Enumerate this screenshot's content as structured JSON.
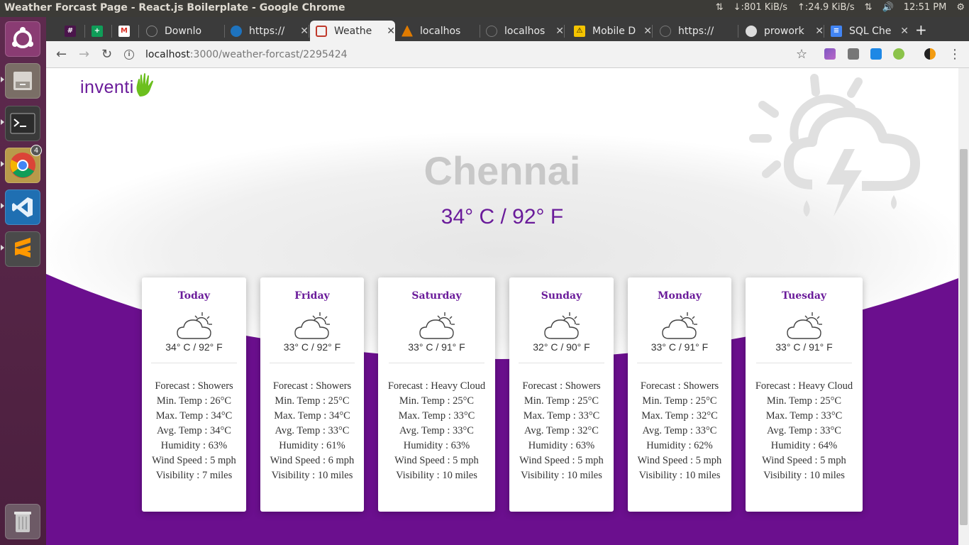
{
  "os": {
    "window_title": "Weather Forcast Page - React.js Boilerplate - Google Chrome",
    "net_down": "↓:801 KiB/s",
    "net_up": "↑:24.9 KiB/s",
    "clock": "12:51 PM",
    "chrome_badge": "4"
  },
  "tabs": [
    {
      "label": "",
      "fav_color": "#4a154b"
    },
    {
      "label": "",
      "fav_color": "#0f9d58"
    },
    {
      "label": "",
      "fav_color": "#ffffff"
    },
    {
      "label": "Downlo",
      "fav_color": "#555555"
    },
    {
      "label": "https://",
      "fav_color": "#1e73be"
    },
    {
      "label": "Weathe",
      "fav_color": "#c0392b"
    },
    {
      "label": "localhos",
      "fav_color": "#e07b00"
    },
    {
      "label": "localhos",
      "fav_color": "#555555"
    },
    {
      "label": "Mobile D",
      "fav_color": "#f5c400"
    },
    {
      "label": "https://",
      "fav_color": "#555555"
    },
    {
      "label": "prowork",
      "fav_color": "#222222"
    },
    {
      "label": "SQL Che",
      "fav_color": "#4285f4"
    }
  ],
  "toolbar": {
    "url_host": "localhost",
    "url_path": ":3000/weather-forcast/2295424"
  },
  "page": {
    "logo_text": "inventi",
    "city": "Chennai",
    "current_temp": "34° C / 92° F",
    "colors": {
      "brand_purple": "#6a1b9a",
      "wave_purple": "#6b0f8e",
      "city_gray": "#c8c8c8",
      "logo_green": "#6cbf1e"
    }
  },
  "forecast": [
    {
      "day": "Today",
      "temp": "34° C / 92° F",
      "forecast": "Forecast : Showers",
      "min": "Min. Temp : 26°C",
      "max": "Max. Temp : 34°C",
      "avg": "Avg. Temp : 34°C",
      "humidity": "Humidity : 63%",
      "wind": "Wind Speed : 5 mph",
      "visibility": "Visibility : 7 miles"
    },
    {
      "day": "Friday",
      "temp": "33° C / 92° F",
      "forecast": "Forecast : Showers",
      "min": "Min. Temp : 25°C",
      "max": "Max. Temp : 34°C",
      "avg": "Avg. Temp : 33°C",
      "humidity": "Humidity : 61%",
      "wind": "Wind Speed : 6 mph",
      "visibility": "Visibility : 10 miles"
    },
    {
      "day": "Saturday",
      "temp": "33° C / 91° F",
      "forecast": "Forecast : Heavy Cloud",
      "min": "Min. Temp : 25°C",
      "max": "Max. Temp : 33°C",
      "avg": "Avg. Temp : 33°C",
      "humidity": "Humidity : 63%",
      "wind": "Wind Speed : 5 mph",
      "visibility": "Visibility : 10 miles"
    },
    {
      "day": "Sunday",
      "temp": "32° C / 90° F",
      "forecast": "Forecast : Showers",
      "min": "Min. Temp : 25°C",
      "max": "Max. Temp : 33°C",
      "avg": "Avg. Temp : 32°C",
      "humidity": "Humidity : 63%",
      "wind": "Wind Speed : 5 mph",
      "visibility": "Visibility : 10 miles"
    },
    {
      "day": "Monday",
      "temp": "33° C / 91° F",
      "forecast": "Forecast : Showers",
      "min": "Min. Temp : 25°C",
      "max": "Max. Temp : 32°C",
      "avg": "Avg. Temp : 33°C",
      "humidity": "Humidity : 62%",
      "wind": "Wind Speed : 5 mph",
      "visibility": "Visibility : 10 miles"
    },
    {
      "day": "Tuesday",
      "temp": "33° C / 91° F",
      "forecast": "Forecast : Heavy Cloud",
      "min": "Min. Temp : 25°C",
      "max": "Max. Temp : 33°C",
      "avg": "Avg. Temp : 33°C",
      "humidity": "Humidity : 64%",
      "wind": "Wind Speed : 5 mph",
      "visibility": "Visibility : 10 miles"
    }
  ]
}
